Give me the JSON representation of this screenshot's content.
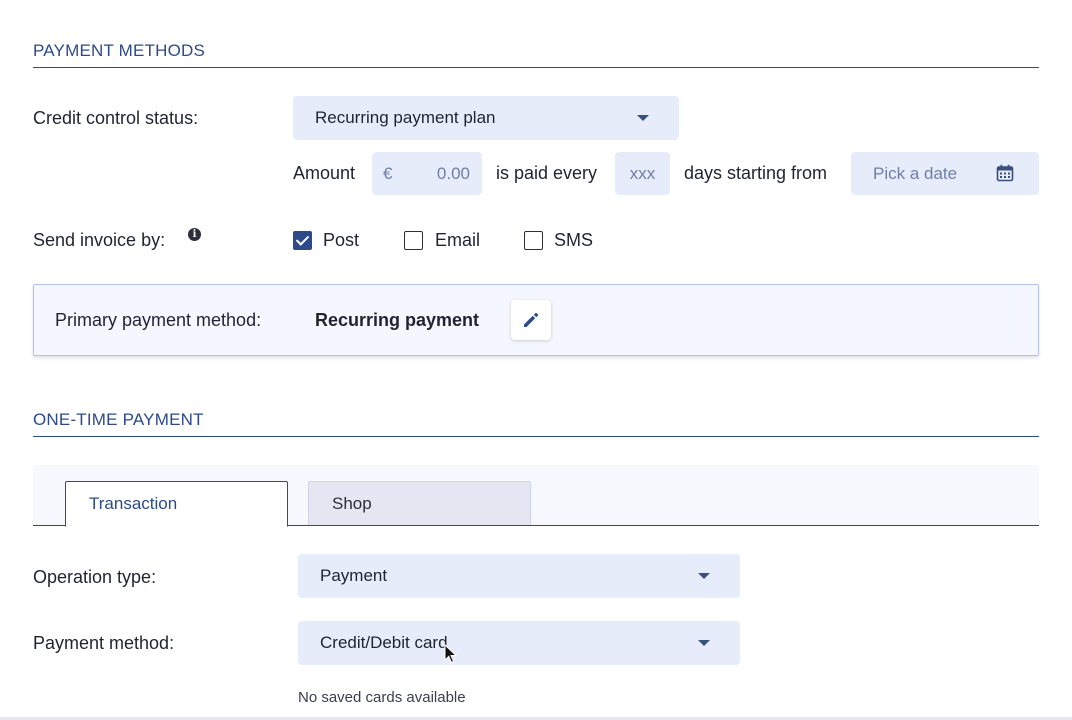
{
  "payment_methods": {
    "section_title": "PAYMENT METHODS",
    "credit_control": {
      "label": "Credit control status:",
      "selected": "Recurring payment plan"
    },
    "schedule": {
      "amount_label": "Amount",
      "currency_symbol": "€",
      "amount_placeholder": "0.00",
      "paid_every_label": "is paid every",
      "days_placeholder": "xxx",
      "days_starting_label": "days starting from",
      "date_placeholder": "Pick a date"
    },
    "send_invoice": {
      "label": "Send invoice by:",
      "options": [
        {
          "label": "Post",
          "checked": true
        },
        {
          "label": "Email",
          "checked": false
        },
        {
          "label": "SMS",
          "checked": false
        }
      ]
    },
    "primary_method": {
      "label": "Primary payment method:",
      "value": "Recurring payment"
    }
  },
  "one_time_payment": {
    "section_title": "ONE-TIME PAYMENT",
    "tabs": [
      {
        "label": "Transaction",
        "active": true
      },
      {
        "label": "Shop",
        "active": false
      }
    ],
    "operation_type": {
      "label": "Operation type:",
      "selected": "Payment"
    },
    "payment_method": {
      "label": "Payment method:",
      "selected": "Credit/Debit card"
    },
    "no_cards_message": "No saved cards available"
  },
  "colors": {
    "accent": "#2d4a8a",
    "field_bg": "#e7ecfb",
    "text": "#1f2430"
  },
  "icons": [
    "info-icon",
    "calendar-icon",
    "pencil-icon",
    "caret-down-icon",
    "checkmark-icon",
    "mouse-pointer-icon"
  ]
}
